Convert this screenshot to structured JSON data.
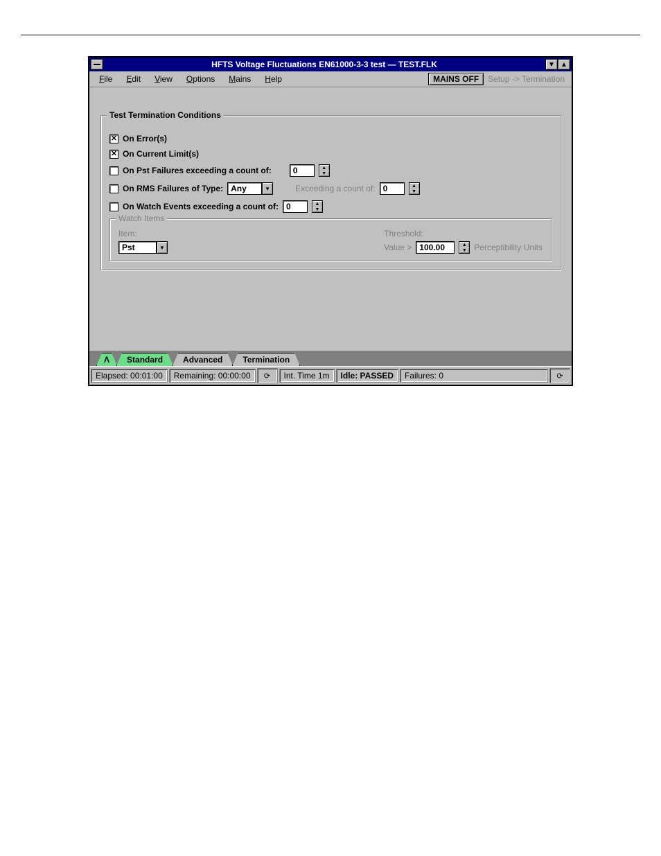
{
  "window": {
    "title": "HFTS Voltage Fluctuations EN61000-3-3 test — TEST.FLK"
  },
  "menu": {
    "file": "File",
    "edit": "Edit",
    "view": "View",
    "options": "Options",
    "mains": "Mains",
    "help": "Help",
    "mains_status": "MAINS OFF",
    "path": "Setup -> Termination"
  },
  "group": {
    "title": "Test Termination Conditions",
    "on_errors": "On Error(s)",
    "on_current_limits": "On Current Limit(s)",
    "on_pst_label": "On Pst Failures exceeding a count of:",
    "on_pst_value": "0",
    "on_rms_label": "On RMS Failures of Type:",
    "rms_type": "Any",
    "rms_exceed_label": "Exceeding a count of:",
    "rms_exceed_value": "0",
    "on_watch_label": "On Watch Events exceeding a count of:",
    "on_watch_value": "0"
  },
  "watch": {
    "title": "Watch Items",
    "item_label": "Item:",
    "item_value": "Pst",
    "threshold_label": "Threshold:",
    "value_prefix": "Value >",
    "value": "100.00",
    "units": "Perceptibility Units"
  },
  "tabs": {
    "t1": "Λ",
    "t2": "Standard",
    "t3": "Advanced",
    "t4": "Termination"
  },
  "status": {
    "elapsed": "Elapsed: 00:01:00",
    "remaining": "Remaining: 00:00:00",
    "intg": "Int. Time 1m",
    "idle": "Idle: PASSED",
    "failures": "Failures: 0"
  }
}
